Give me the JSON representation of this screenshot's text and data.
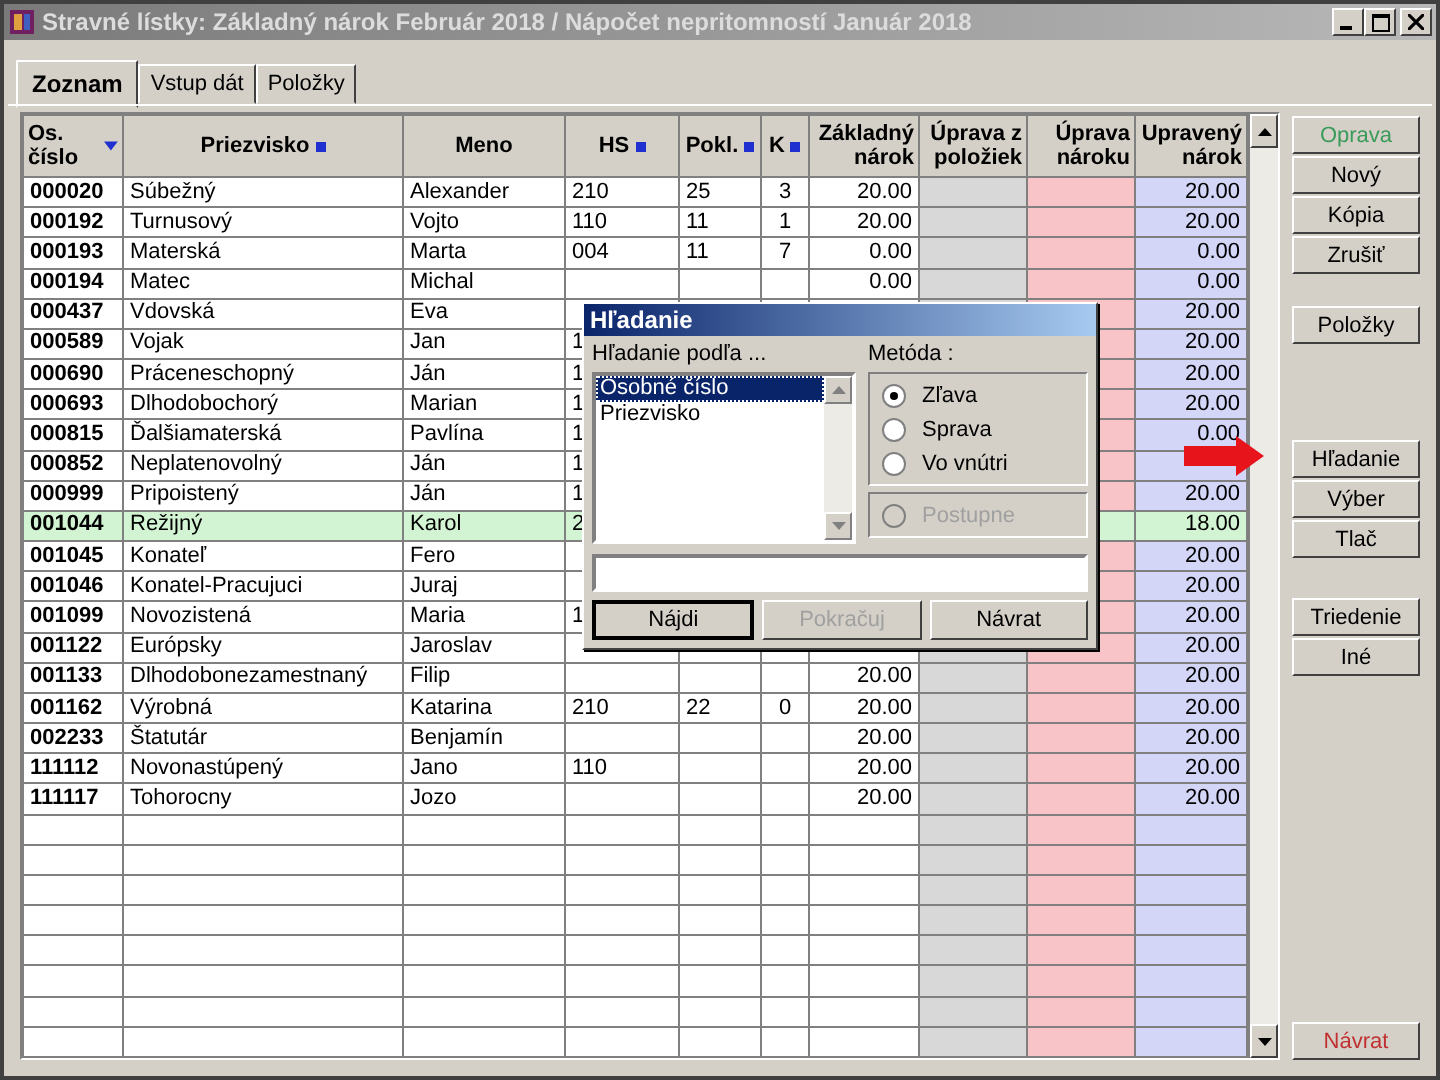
{
  "window": {
    "title": "Stravné lístky:  Základný nárok Február 2018  /  Nápočet nepritomností Január 2018"
  },
  "tabs": [
    {
      "label": "Zoznam",
      "selected": true
    },
    {
      "label": "Vstup dát",
      "selected": false
    },
    {
      "label": "Položky",
      "selected": false
    }
  ],
  "table": {
    "columns": [
      {
        "label": "Os. číslo",
        "sorted": true
      },
      {
        "label": "Priezvisko",
        "sortable": true
      },
      {
        "label": "Meno"
      },
      {
        "label": "HS",
        "sortable": true
      },
      {
        "label": "Pokl.",
        "sortable": true
      },
      {
        "label": "K",
        "sortable": true
      },
      {
        "label": "Základný nárok",
        "color": "#ffffff"
      },
      {
        "label": "Úprava z položiek",
        "color": "#d8d8d8"
      },
      {
        "label": "Úprava nároku",
        "color": "#f8c4c8"
      },
      {
        "label": "Upravený nárok",
        "color": "#d4d6f8"
      }
    ],
    "rows": [
      {
        "selected": false,
        "number": "000020",
        "surname": "Súbežný",
        "name": "Alexander",
        "hs": "210",
        "pokl": "25",
        "k": "3",
        "base": "20.00",
        "adjusted": "20.00"
      },
      {
        "selected": false,
        "number": "000192",
        "surname": "Turnusový",
        "name": "Vojto",
        "hs": "110",
        "pokl": "11",
        "k": "1",
        "base": "20.00",
        "adjusted": "20.00"
      },
      {
        "selected": false,
        "number": "000193",
        "surname": "Materská",
        "name": "Marta",
        "hs": "004",
        "pokl": "11",
        "k": "7",
        "base": "0.00",
        "adjusted": "0.00"
      },
      {
        "selected": false,
        "number": "000194",
        "surname": "Matec",
        "name": "Michal",
        "base": "0.00",
        "adjusted": "0.00"
      },
      {
        "selected": false,
        "number": "000437",
        "surname": "Vdovská",
        "name": "Eva",
        "adjusted": "20.00"
      },
      {
        "selected": false,
        "number": "000589",
        "surname": "Vojak",
        "name": "Jan",
        "hs": "1",
        "adjusted": "20.00"
      },
      {
        "selected": false,
        "number": "000690",
        "surname": "Práceneschopný",
        "name": "Ján",
        "hs": "1",
        "adjusted": "20.00"
      },
      {
        "selected": false,
        "number": "000693",
        "surname": "Dlhodobochorý",
        "name": "Marian",
        "hs": "1",
        "adjusted": "20.00"
      },
      {
        "selected": false,
        "number": "000815",
        "surname": "Ďalšiamaterská",
        "name": "Pavlína",
        "hs": "1",
        "adjusted": "0.00"
      },
      {
        "selected": false,
        "number": "000852",
        "surname": "Neplatenovolný",
        "name": "Ján",
        "hs": "1"
      },
      {
        "selected": false,
        "number": "000999",
        "surname": "Pripoistený",
        "name": "Ján",
        "hs": "1",
        "adjusted": "20.00"
      },
      {
        "selected": true,
        "number": "001044",
        "surname": "Režijný",
        "name": "Karol",
        "hs": "2",
        "adjusted": "18.00"
      },
      {
        "selected": false,
        "number": "001045",
        "surname": "Konateľ",
        "name": "Fero",
        "adjusted": "20.00"
      },
      {
        "selected": false,
        "number": "001046",
        "surname": "Konatel-Pracujuci",
        "name": "Juraj",
        "adjusted": "20.00"
      },
      {
        "selected": false,
        "number": "001099",
        "surname": "Novozistená",
        "name": "Maria",
        "hs": "1",
        "adjusted": "20.00"
      },
      {
        "selected": false,
        "number": "001122",
        "surname": "Európsky",
        "name": "Jaroslav",
        "adjusted": "20.00"
      },
      {
        "selected": false,
        "number": "001133",
        "surname": "Dlhodobonezamestnaný",
        "name": "Filip",
        "base": "20.00",
        "adjusted": "20.00"
      },
      {
        "selected": false,
        "number": "001162",
        "surname": "Výrobná",
        "name": "Katarina",
        "hs": "210",
        "pokl": "22",
        "k": "0",
        "base": "20.00",
        "adjusted": "20.00"
      },
      {
        "selected": false,
        "number": "002233",
        "surname": "Štatutár",
        "name": "Benjamín",
        "base": "20.00",
        "adjusted": "20.00"
      },
      {
        "selected": false,
        "number": "111112",
        "surname": "Novonastúpený",
        "name": "Jano",
        "hs": "110",
        "base": "20.00",
        "adjusted": "20.00"
      },
      {
        "selected": false,
        "number": "111117",
        "surname": "Tohorocny",
        "name": "Jozo",
        "base": "20.00",
        "adjusted": "20.00"
      }
    ]
  },
  "button_groups": [
    [
      {
        "label": "Oprava",
        "kind": "accept",
        "marked": false
      },
      {
        "label": "Nový",
        "kind": "normal",
        "marked": false
      },
      {
        "label": "Kópia",
        "kind": "normal",
        "marked": false
      },
      {
        "label": "Zrušiť",
        "kind": "normal",
        "marked": false
      }
    ],
    [
      {
        "label": "Položky",
        "kind": "normal",
        "marked": false
      }
    ],
    [
      {
        "label": "Hľadanie",
        "kind": "normal",
        "marked": true
      },
      {
        "label": "Výber",
        "kind": "normal",
        "marked": false
      },
      {
        "label": "Tlač",
        "kind": "normal",
        "marked": false
      }
    ],
    [
      {
        "label": "Triedenie",
        "kind": "normal",
        "marked": false
      },
      {
        "label": "Iné",
        "kind": "normal",
        "marked": false
      }
    ]
  ],
  "close_button": {
    "label": "Návrat"
  },
  "dialog": {
    "title": "Hľadanie",
    "search_by": {
      "label": "Hľadanie podľa ...",
      "items": [
        {
          "label": "Osobné číslo",
          "selected": true
        },
        {
          "label": "Priezvisko",
          "selected": false
        }
      ]
    },
    "method": {
      "label": "Metóda :",
      "options": [
        {
          "label": "Zľava",
          "selected": true,
          "disabled": false
        },
        {
          "label": "Sprava",
          "selected": false,
          "disabled": false
        },
        {
          "label": "Vo vnútri",
          "selected": false,
          "disabled": false
        }
      ],
      "extra_option": {
        "label": "Postupne",
        "selected": false,
        "disabled": true
      }
    },
    "buttons": [
      {
        "label": "Nájdi",
        "disabled": false,
        "default": true
      },
      {
        "label": "Pokračuj",
        "disabled": true,
        "default": false
      },
      {
        "label": "Návrat",
        "disabled": false,
        "default": false
      }
    ]
  }
}
